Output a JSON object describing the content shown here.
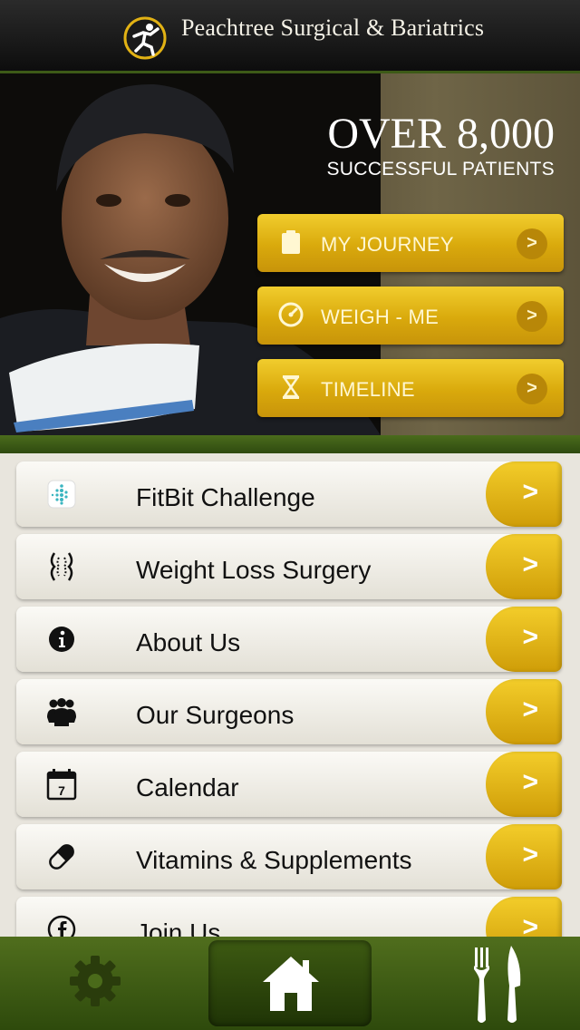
{
  "header": {
    "brand": "Peachtree Surgical & Bariatrics",
    "logo_icon": "runner-logo-icon"
  },
  "hero": {
    "headline": "OVER 8,000",
    "subheadline": "SUCCESSFUL PATIENTS",
    "buttons": [
      {
        "label": "MY JOURNEY",
        "icon": "clipboard-icon"
      },
      {
        "label": "WEIGH - ME",
        "icon": "gauge-icon"
      },
      {
        "label": "TIMELINE",
        "icon": "hourglass-icon"
      }
    ]
  },
  "menu": {
    "items": [
      {
        "label": "FitBit Challenge",
        "icon": "fitbit-icon"
      },
      {
        "label": "Weight Loss Surgery",
        "icon": "body-shape-icon"
      },
      {
        "label": "About Us",
        "icon": "info-icon"
      },
      {
        "label": "Our Surgeons",
        "icon": "group-icon"
      },
      {
        "label": "Calendar",
        "icon": "calendar-icon",
        "badge": "7"
      },
      {
        "label": "Vitamins & Supplements",
        "icon": "pill-icon"
      },
      {
        "label": "Join Us",
        "icon": "facebook-icon"
      }
    ],
    "arrow": ">"
  },
  "tabbar": {
    "tabs": [
      {
        "name": "settings",
        "icon": "gear-icon"
      },
      {
        "name": "home",
        "icon": "home-icon",
        "selected": true
      },
      {
        "name": "dining",
        "icon": "fork-knife-icon"
      }
    ]
  },
  "colors": {
    "gold": "#e0b010",
    "green": "#3d5a17",
    "header": "#111111"
  }
}
